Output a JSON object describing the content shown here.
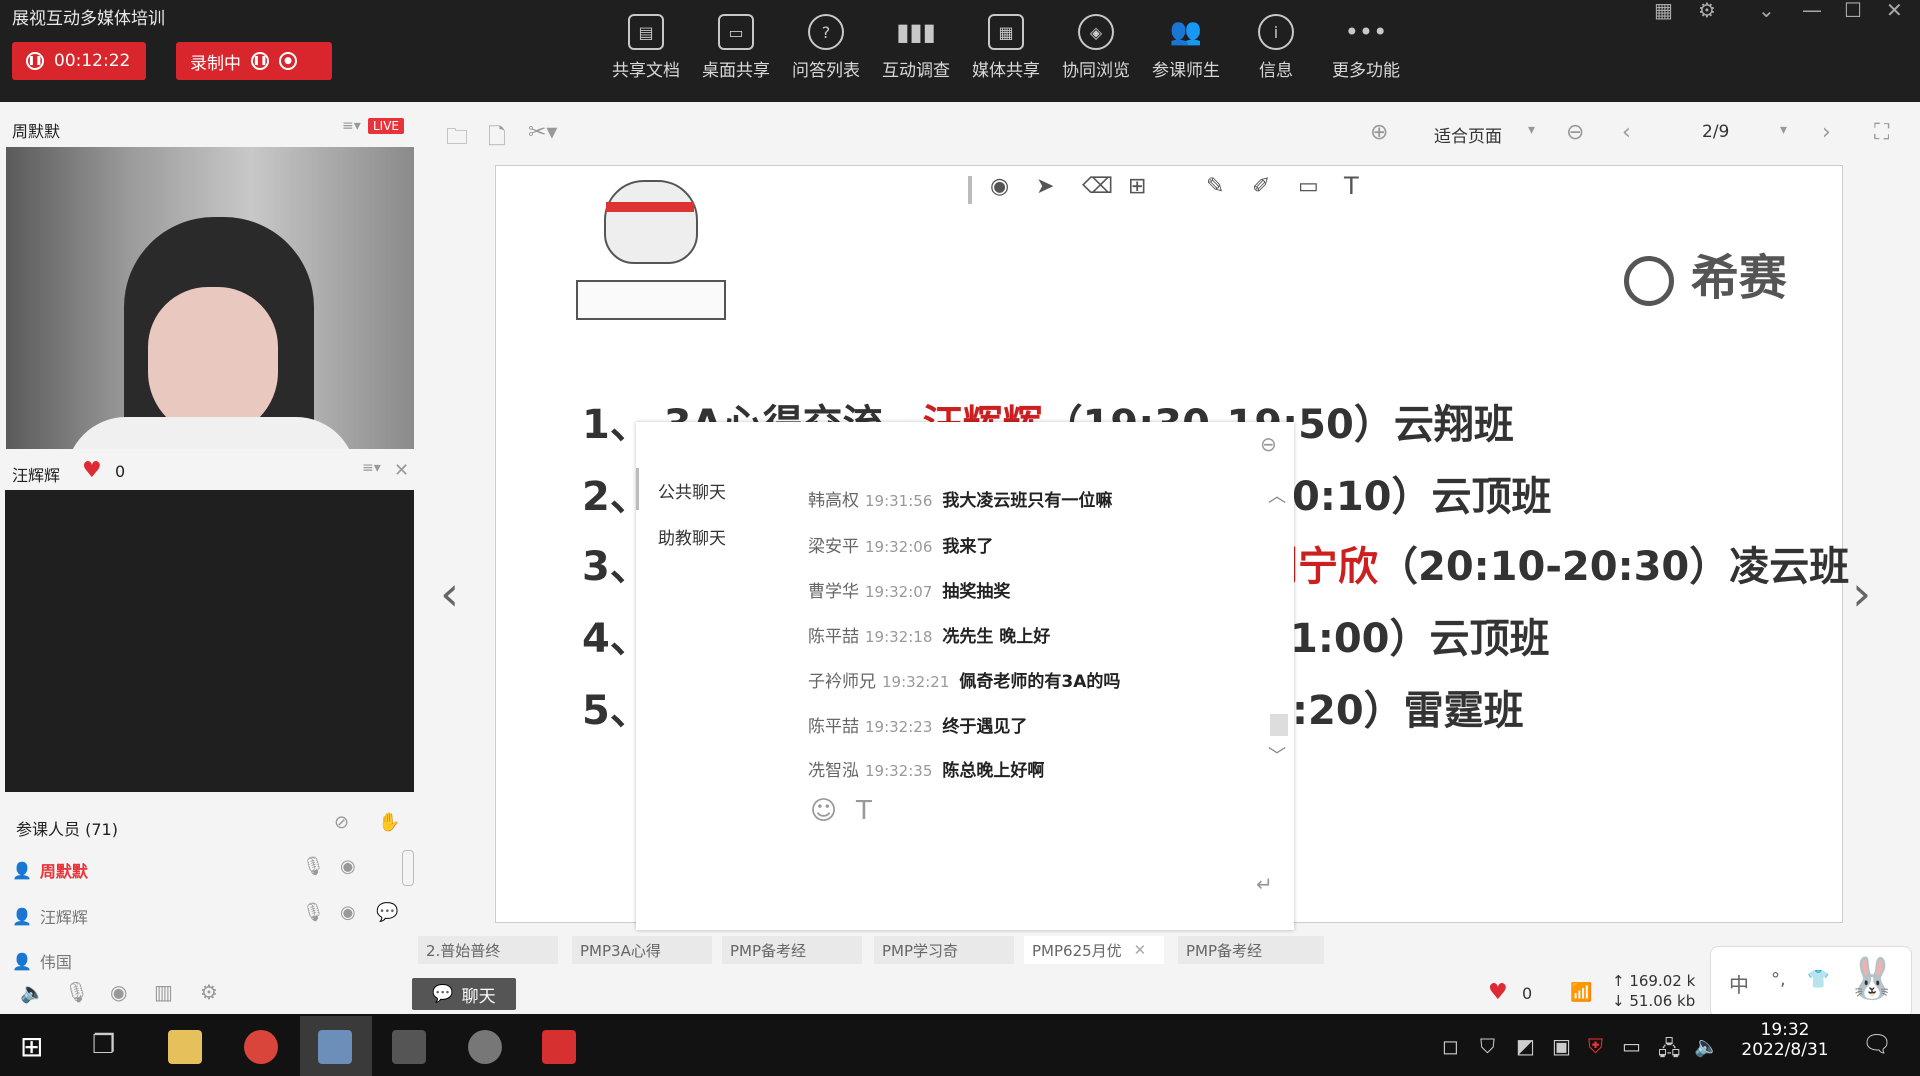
{
  "app": {
    "title": "展视互动多媒体培训"
  },
  "recording": {
    "timer": "00:12:22",
    "status": "录制中"
  },
  "toolbar": [
    {
      "label": "共享文档",
      "icon": "document-icon"
    },
    {
      "label": "桌面共享",
      "icon": "desktop-share-icon"
    },
    {
      "label": "问答列表",
      "icon": "qa-icon"
    },
    {
      "label": "互动调查",
      "icon": "survey-chart-icon"
    },
    {
      "label": "媒体共享",
      "icon": "media-icon"
    },
    {
      "label": "协同浏览",
      "icon": "compass-icon"
    },
    {
      "label": "参课师生",
      "icon": "users-icon"
    },
    {
      "label": "信息",
      "icon": "info-icon"
    },
    {
      "label": "更多功能",
      "icon": "more-icon"
    }
  ],
  "presenter": {
    "name": "周默默",
    "live_badge": "LIVE"
  },
  "second_video": {
    "name": "汪辉辉",
    "likes": "0"
  },
  "participants": {
    "header": "参课人员 (71)",
    "list": [
      "周默默",
      "汪辉辉",
      "伟国"
    ]
  },
  "doc_toolbar": {
    "zoom": "适合页面",
    "page": "2/9"
  },
  "slide": {
    "brand": "希赛",
    "lines": [
      {
        "num": "1、",
        "text_a": "3A心得交流—",
        "text_red": "汪辉辉",
        "text_b": "（19:30-19:50）云翔班"
      },
      {
        "num": "2、",
        "text_tail": "0:10）云顶班"
      },
      {
        "num": "3、",
        "text_red": "刘宁欣",
        "text_b": "（20:10-20:30）凌云班"
      },
      {
        "num": "4、",
        "text_tail": "1:00）云顶班"
      },
      {
        "num": "5、",
        "text_tail": ":20）雷霆班"
      }
    ]
  },
  "chat": {
    "tabs": [
      "公共聊天",
      "助教聊天"
    ],
    "messages": [
      {
        "who": "韩高权",
        "time": "19:31:56",
        "text": "我大凌云班只有一位嘛"
      },
      {
        "who": "梁安平",
        "time": "19:32:06",
        "text": "我来了"
      },
      {
        "who": "曹学华",
        "time": "19:32:07",
        "text": "抽奖抽奖"
      },
      {
        "who": "陈平喆",
        "time": "19:32:18",
        "text": "冼先生  晚上好"
      },
      {
        "who": "子衿师兄",
        "time": "19:32:21",
        "text": "佩奇老师的有3A的吗"
      },
      {
        "who": "陈平喆",
        "time": "19:32:23",
        "text": "终于遇见了"
      },
      {
        "who": "冼智泓",
        "time": "19:32:35",
        "text": "陈总晚上好啊"
      }
    ]
  },
  "file_tabs": [
    "2.普始普终",
    "PMP3A心得",
    "PMP备考经",
    "PMP学习奇",
    "PMP625月优",
    "PMP备考经"
  ],
  "chat_button": "聊天",
  "status": {
    "likes": "0",
    "upload": "169.02 k",
    "download": "51.06 kb"
  },
  "ime": {
    "label": "中"
  },
  "clock": {
    "time": "19:32",
    "date": "2022/8/31"
  }
}
